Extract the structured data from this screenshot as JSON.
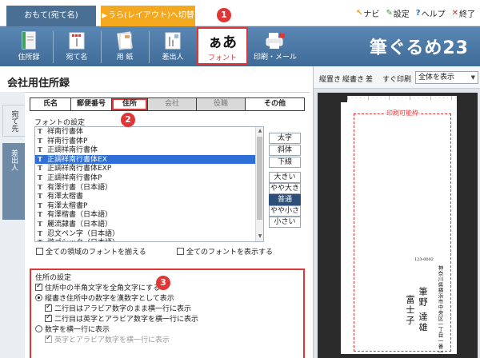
{
  "top_tabs": {
    "front": "おもて(宛て名)",
    "back": "うら(レイアウト)へ切替"
  },
  "top_links": {
    "navi": "ナビ",
    "settings": "設定",
    "help": "ヘルプ",
    "exit": "終了"
  },
  "toolbar": {
    "items": [
      "住所録",
      "宛て名",
      "用 紙",
      "差出人",
      "フォント",
      "印刷・メール"
    ],
    "brand": "筆ぐるめ23",
    "font_icon_text": "ぁあ"
  },
  "panel": {
    "title": "会社用住所録",
    "side_tabs": [
      "宛て先",
      "差出人"
    ],
    "sub_tabs": [
      "氏名",
      "郵便番号",
      "住所",
      "会社",
      "役職",
      "その他"
    ],
    "font_group_label": "フォントの設定",
    "fonts": [
      "祥南行書体",
      "祥南行書体P",
      "正調祥南行書体",
      "正調祥南行書体EX",
      "正調祥南行書体EXP",
      "正調祥南行書体P",
      "有澤行書（日本語）",
      "有澤太楷書",
      "有澤太楷書P",
      "有澤楷書（日本語）",
      "麗流隷書（日本語）",
      "忍文ペン字（日本語）",
      "游ゴシック（日本語）"
    ],
    "selected_font": "正調祥南行書体EX",
    "style_buttons": [
      "太字",
      "斜体",
      "下線"
    ],
    "size_buttons": [
      "大きい",
      "やや大きい",
      "普通",
      "やや小さい",
      "小さい"
    ],
    "size_selected": "普通",
    "chk_all_fields": "全ての領域のフォントを揃える",
    "chk_all_fonts": "全てのフォントを表示する",
    "address_group_label": "住所の設定",
    "opt_halfwidth": "住所中の半角文字を全角文字にする",
    "opt_kanji": "縦書き住所中の数字を漢数字として表示",
    "opt_line2_arabic": "二行目はアラビア数字のまま横一行に表示",
    "opt_line2_alpha": "二行目は英字とアラビア数字を横一行に表示",
    "opt_horizontal": "数字を横一行に表示",
    "opt_horizontal_sub": "英字とアラビア数字を横一行に表示"
  },
  "badges": [
    "1",
    "2",
    "3"
  ],
  "preview": {
    "toolbar": [
      "縦置き",
      "縦書き",
      "差",
      "すぐ印刷"
    ],
    "view_select": "全体を表示",
    "printable_label": "印刷可能枠",
    "zip": "123-0002",
    "address": "神奈川県横浜市中央区一丁目一番一",
    "name_line1": "筆野 達雄",
    "name_line2": "富士子"
  }
}
